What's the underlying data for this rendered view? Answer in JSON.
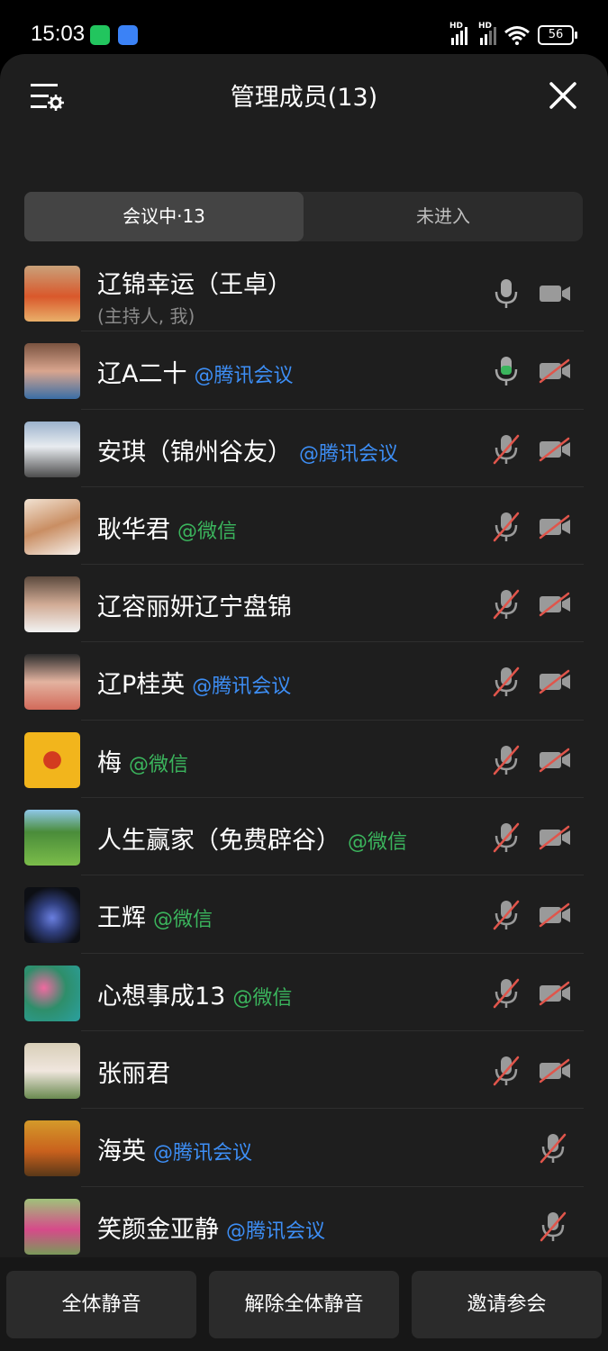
{
  "status": {
    "time": "15:03",
    "battery": "56",
    "net1": "HD",
    "net2": "HD"
  },
  "header": {
    "title": "管理成员(13)"
  },
  "tabs": [
    {
      "label": "会议中·13",
      "active": true
    },
    {
      "label": "未进入",
      "active": false
    }
  ],
  "members": [
    {
      "name": "辽锦幸运（王卓）",
      "sub": "(主持人, 我)",
      "tag": "",
      "tag_type": "",
      "mic": "on",
      "cam": "on"
    },
    {
      "name": "辽A二十",
      "tag": "@腾讯会议",
      "tag_type": "tx",
      "mic": "speaking",
      "cam": "off"
    },
    {
      "name": "安琪（锦州谷友）",
      "tag": "@腾讯会议",
      "tag_type": "tx",
      "mic": "off",
      "cam": "off"
    },
    {
      "name": "耿华君",
      "tag": "@微信",
      "tag_type": "wx",
      "mic": "off",
      "cam": "off"
    },
    {
      "name": "辽容丽妍辽宁盘锦",
      "tag": "",
      "tag_type": "",
      "mic": "off",
      "cam": "off"
    },
    {
      "name": "辽P桂英",
      "tag": "@腾讯会议",
      "tag_type": "tx",
      "mic": "off",
      "cam": "off"
    },
    {
      "name": "梅",
      "tag": "@微信",
      "tag_type": "wx",
      "mic": "off",
      "cam": "off"
    },
    {
      "name": "人生赢家（免费辟谷）",
      "tag": "@微信",
      "tag_type": "wx",
      "mic": "off",
      "cam": "off"
    },
    {
      "name": "王辉",
      "tag": "@微信",
      "tag_type": "wx",
      "mic": "off",
      "cam": "off"
    },
    {
      "name": "心想事成13",
      "tag": "@微信",
      "tag_type": "wx",
      "mic": "off",
      "cam": "off"
    },
    {
      "name": "张丽君",
      "tag": "",
      "tag_type": "",
      "mic": "off",
      "cam": "off"
    },
    {
      "name": "海英",
      "tag": "@腾讯会议",
      "tag_type": "tx",
      "mic": "off",
      "cam": "none"
    },
    {
      "name": "笑颜金亚静",
      "tag": "@腾讯会议",
      "tag_type": "tx",
      "mic": "off",
      "cam": "none"
    }
  ],
  "buttons": {
    "mute_all": "全体静音",
    "unmute_all": "解除全体静音",
    "invite": "邀请参会"
  },
  "colors": {
    "tencent": "#3d8ef5",
    "wechat": "#3bb55d",
    "muted": "#e0554b",
    "speaking": "#3bb55d"
  }
}
